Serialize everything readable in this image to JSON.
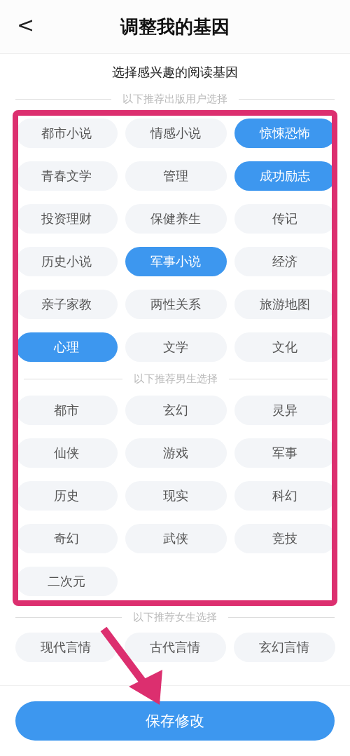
{
  "header": {
    "back": "<",
    "title": "调整我的基因"
  },
  "subtitle": "选择感兴趣的阅读基因",
  "sections": [
    {
      "label": "以下推荐出版用户选择",
      "chips": [
        {
          "label": "都市小说",
          "selected": false
        },
        {
          "label": "情感小说",
          "selected": false
        },
        {
          "label": "惊悚恐怖",
          "selected": true
        },
        {
          "label": "青春文学",
          "selected": false
        },
        {
          "label": "管理",
          "selected": false
        },
        {
          "label": "成功励志",
          "selected": true
        },
        {
          "label": "投资理财",
          "selected": false
        },
        {
          "label": "保健养生",
          "selected": false
        },
        {
          "label": "传记",
          "selected": false
        },
        {
          "label": "历史小说",
          "selected": false
        },
        {
          "label": "军事小说",
          "selected": true
        },
        {
          "label": "经济",
          "selected": false
        },
        {
          "label": "亲子家教",
          "selected": false
        },
        {
          "label": "两性关系",
          "selected": false
        },
        {
          "label": "旅游地图",
          "selected": false
        },
        {
          "label": "心理",
          "selected": true
        },
        {
          "label": "文学",
          "selected": false
        },
        {
          "label": "文化",
          "selected": false
        }
      ]
    },
    {
      "label": "以下推荐男生选择",
      "chips": [
        {
          "label": "都市",
          "selected": false
        },
        {
          "label": "玄幻",
          "selected": false
        },
        {
          "label": "灵异",
          "selected": false
        },
        {
          "label": "仙侠",
          "selected": false
        },
        {
          "label": "游戏",
          "selected": false
        },
        {
          "label": "军事",
          "selected": false
        },
        {
          "label": "历史",
          "selected": false
        },
        {
          "label": "现实",
          "selected": false
        },
        {
          "label": "科幻",
          "selected": false
        },
        {
          "label": "奇幻",
          "selected": false
        },
        {
          "label": "武侠",
          "selected": false
        },
        {
          "label": "竞技",
          "selected": false
        },
        {
          "label": "二次元",
          "selected": false
        }
      ]
    },
    {
      "label": "以下推荐女生选择",
      "chips": [
        {
          "label": "现代言情",
          "selected": false
        },
        {
          "label": "古代言情",
          "selected": false
        },
        {
          "label": "玄幻言情",
          "selected": false
        }
      ]
    }
  ],
  "save_button": "保存修改"
}
